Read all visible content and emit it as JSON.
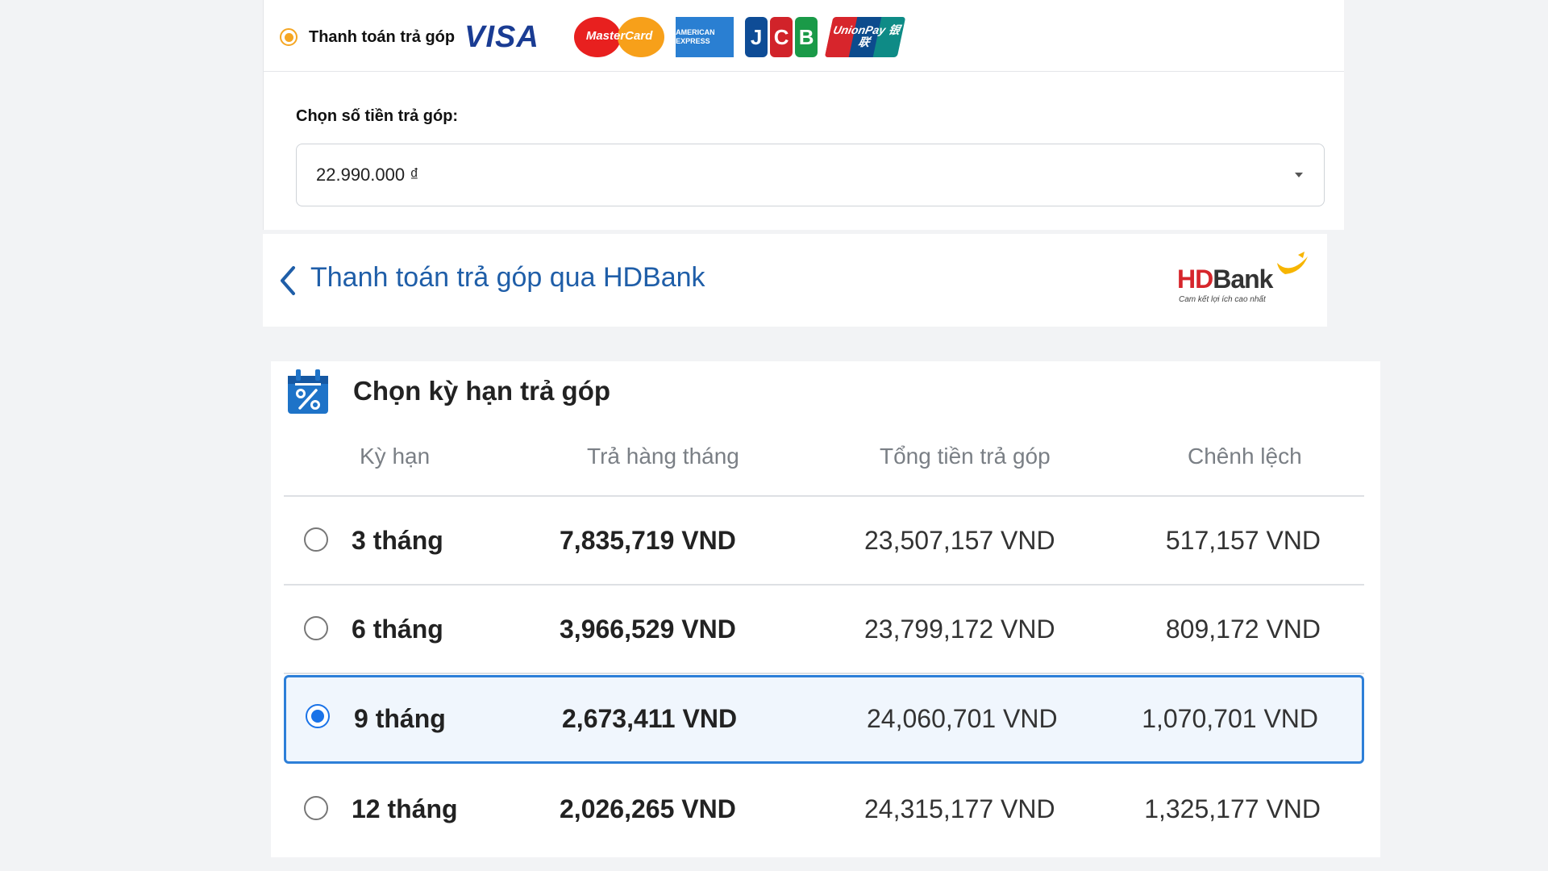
{
  "payment": {
    "option_label": "Thanh toán trả góp",
    "cards": [
      {
        "name": "VISA"
      },
      {
        "name": "MasterCard"
      },
      {
        "name": "AMERICAN EXPRESS"
      },
      {
        "name": "JCB"
      },
      {
        "name": "UnionPay 银联"
      }
    ],
    "amount_label": "Chọn số tiền trả góp:",
    "amount_value": "22.990.000 ₫"
  },
  "bank": {
    "title": "Thanh toán trả góp qua HDBank",
    "logo_hd": "HD",
    "logo_bank": "Bank",
    "logo_tagline": "Cam kết lợi ích cao nhất"
  },
  "terms": {
    "title": "Chọn kỳ hạn trả góp",
    "columns": [
      "Kỳ hạn",
      "Trả hàng tháng",
      "Tổng tiền trả góp",
      "Chênh lệch"
    ],
    "rows": [
      {
        "term": "3 tháng",
        "monthly": "7,835,719 VND",
        "total": "23,507,157 VND",
        "diff": "517,157 VND",
        "selected": false
      },
      {
        "term": "6 tháng",
        "monthly": "3,966,529 VND",
        "total": "23,799,172 VND",
        "diff": "809,172 VND",
        "selected": false
      },
      {
        "term": "9 tháng",
        "monthly": "2,673,411 VND",
        "total": "24,060,701 VND",
        "diff": "1,070,701 VND",
        "selected": true
      },
      {
        "term": "12 tháng",
        "monthly": "2,026,265 VND",
        "total": "24,315,177 VND",
        "diff": "1,325,177 VND",
        "selected": false
      }
    ]
  },
  "colors": {
    "accent_orange": "#f5a623",
    "selected_blue": "#2d7fd8",
    "bank_title_blue": "#1f5ea8",
    "hdbank_red": "#d6252b",
    "hdbank_yellow": "#f7b500"
  }
}
